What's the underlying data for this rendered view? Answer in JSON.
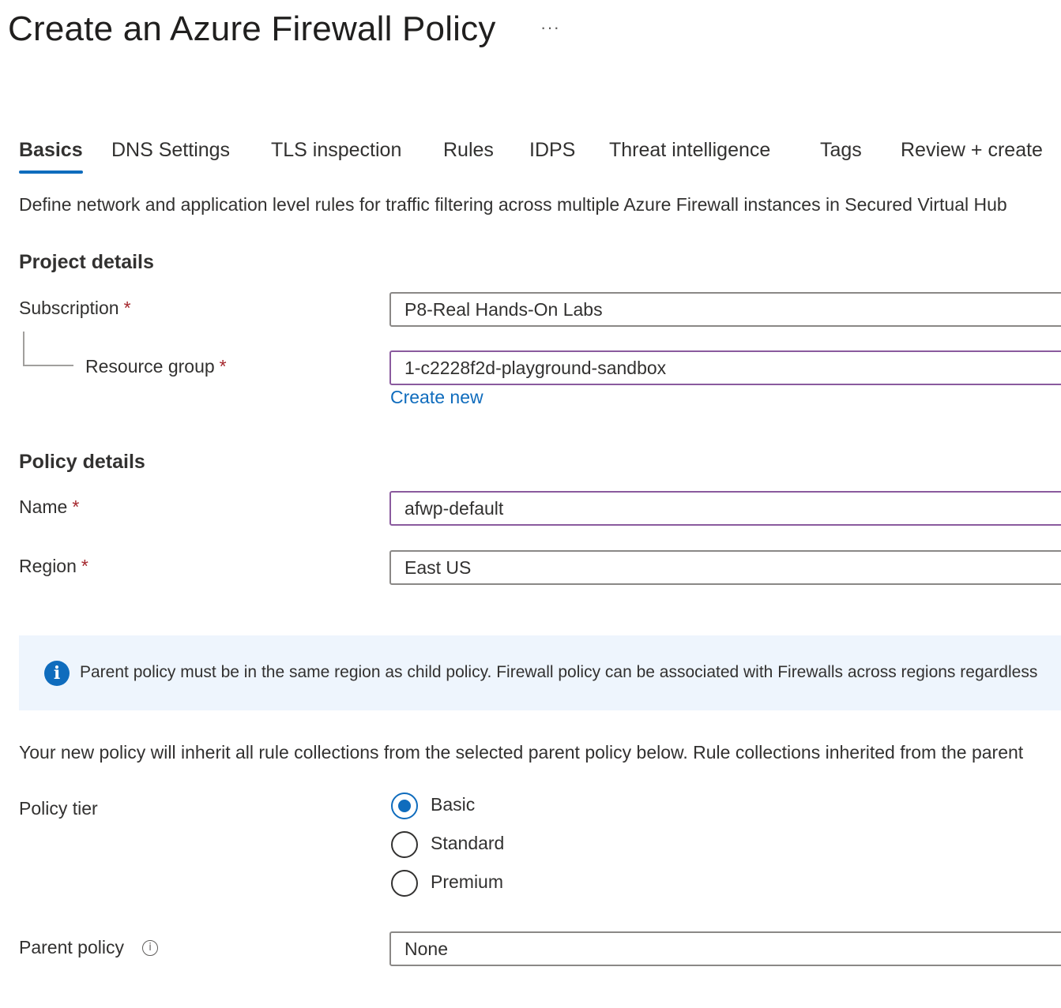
{
  "page": {
    "title": "Create an Azure Firewall Policy",
    "more_label": "···"
  },
  "tabs": [
    {
      "label": "Basics",
      "active": true
    },
    {
      "label": "DNS Settings"
    },
    {
      "label": "TLS inspection"
    },
    {
      "label": "Rules"
    },
    {
      "label": "IDPS"
    },
    {
      "label": "Threat intelligence"
    },
    {
      "label": "Tags"
    },
    {
      "label": "Review + create"
    }
  ],
  "description": "Define network and application level rules for traffic filtering across multiple Azure Firewall instances in Secured Virtual Hub",
  "project_details": {
    "heading": "Project details",
    "subscription_label": "Subscription",
    "subscription_value": "P8-Real Hands-On Labs",
    "resource_group_label": "Resource group",
    "resource_group_value": "1-c2228f2d-playground-sandbox",
    "create_new_link": "Create new"
  },
  "policy_details": {
    "heading": "Policy details",
    "name_label": "Name",
    "name_value": "afwp-default",
    "region_label": "Region",
    "region_value": "East US"
  },
  "required_marker": "*",
  "info_banner": {
    "icon": "info-icon",
    "icon_glyph": "i",
    "text": "Parent policy must be in the same region as child policy. Firewall policy can be associated with Firewalls across regions regardless"
  },
  "inherit_text": "Your new policy will inherit all rule collections from the selected parent policy below. Rule collections inherited from the parent",
  "policy_tier": {
    "label": "Policy tier",
    "options": [
      {
        "label": "Basic",
        "selected": true
      },
      {
        "label": "Standard",
        "selected": false
      },
      {
        "label": "Premium",
        "selected": false
      }
    ]
  },
  "parent_policy": {
    "label": "Parent policy",
    "help_icon": "info-outline-icon",
    "help_glyph": "i",
    "value": "None"
  },
  "colors": {
    "accent": "#0f6cbd",
    "required": "#a4262c",
    "focus_border": "#8a5a9e",
    "info_bg": "#eef5fd"
  }
}
